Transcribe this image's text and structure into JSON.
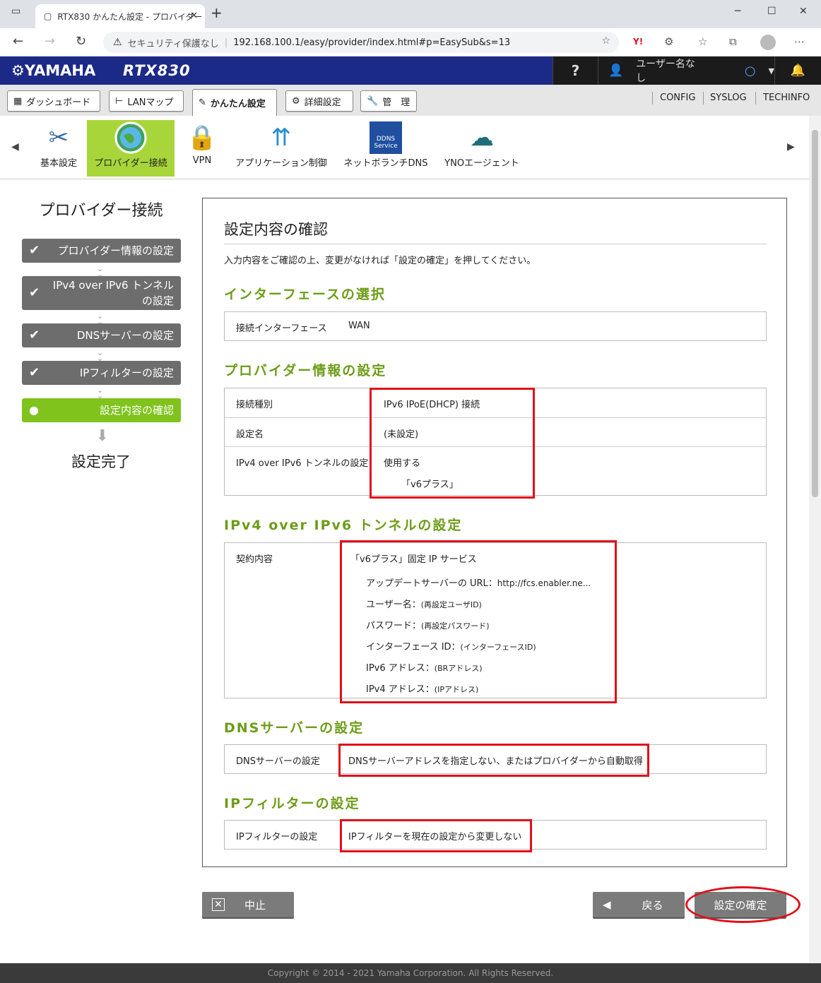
{
  "browser": {
    "tab_title": "RTX830 かんたん設定 - プロバイダー",
    "security": "セキュリティ保護なし",
    "url": "192.168.100.1/easy/provider/index.html#p=EasySub&s=13"
  },
  "header": {
    "logo": "YAMAHA",
    "model": "RTX830",
    "help": "?",
    "user": "ユーザー名なし"
  },
  "menu": {
    "tabs": [
      "ダッシュボード",
      "LANマップ",
      "かんたん設定",
      "詳細設定",
      "管　理"
    ],
    "links": [
      "CONFIG",
      "SYSLOG",
      "TECHINFO"
    ]
  },
  "features": [
    {
      "label": "基本設定"
    },
    {
      "label": "プロバイダー接続"
    },
    {
      "label": "VPN"
    },
    {
      "label": "アプリケーション制御"
    },
    {
      "label": "ネットボランチDNS",
      "icon_text": "DDNS Service"
    },
    {
      "label": "YNOエージェント"
    }
  ],
  "sidebar": {
    "title": "プロバイダー接続",
    "steps": [
      "プロバイダー情報の設定",
      "IPv4 over IPv6 トンネル",
      "の設定",
      "DNSサーバーの設定",
      "IPフィルターの設定",
      "設定内容の確認"
    ],
    "done": "設定完了"
  },
  "panel": {
    "title": "設定内容の確認",
    "instruction": "入力内容をご確認の上、変更がなければ「設定の確定」を押してください。",
    "sections": {
      "interface": {
        "heading": "インターフェースの選択",
        "label": "接続インターフェース",
        "value": "WAN"
      },
      "provider": {
        "heading": "プロバイダー情報の設定",
        "rows": [
          {
            "label": "接続種別",
            "value": "IPv6 IPoE(DHCP) 接続"
          },
          {
            "label": "設定名",
            "value": "(未設定)"
          },
          {
            "label": "IPv4 over IPv6 トンネルの設定",
            "value": "使用する",
            "value2": "「v6プラス」"
          }
        ]
      },
      "tunnel": {
        "heading": "IPv4 over IPv6 トンネルの設定",
        "label": "契約内容",
        "service": "「v6プラス」固定 IP サービス",
        "lines": [
          {
            "k": "アップデートサーバーの URL：",
            "v": "http://fcs.enabler.ne..."
          },
          {
            "k": "ユーザー名：",
            "v": "(再設定ユーザID)"
          },
          {
            "k": "パスワード：",
            "v": "(再設定パスワード)"
          },
          {
            "k": "インターフェース ID：",
            "v": "(インターフェースID)"
          },
          {
            "k": "IPv6 アドレス：",
            "v": "(BRアドレス)"
          },
          {
            "k": "IPv4 アドレス：",
            "v": "(IPアドレス)"
          }
        ]
      },
      "dns": {
        "heading": "DNSサーバーの設定",
        "label": "DNSサーバーの設定",
        "value": "DNSサーバーアドレスを指定しない、またはプロバイダーから自動取得"
      },
      "filter": {
        "heading": "IPフィルターの設定",
        "label": "IPフィルターの設定",
        "value": "IPフィルターを現在の設定から変更しない"
      }
    }
  },
  "buttons": {
    "cancel": "中止",
    "back": "戻る",
    "confirm": "設定の確定"
  },
  "footer": "Copyright © 2014 - 2021 Yamaha Corporation. All Rights Reserved.",
  "colors": {
    "header_blue": "#1c2a87",
    "accent_green": "#7fc31c",
    "section_green": "#6c9d17",
    "highlight_red": "#e0101a"
  }
}
